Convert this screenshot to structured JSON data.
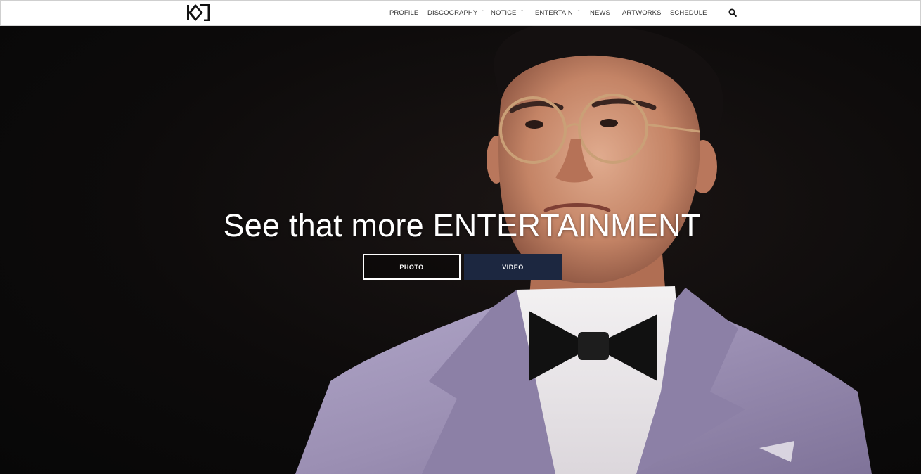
{
  "header": {
    "logo_alt": "KJ",
    "nav": [
      {
        "label": "PROFILE",
        "has_dropdown": false
      },
      {
        "label": "DISCOGRAPHY",
        "has_dropdown": true
      },
      {
        "label": "NOTICE",
        "has_dropdown": true
      },
      {
        "label": "ENTERTAIN",
        "has_dropdown": true
      },
      {
        "label": "NEWS",
        "has_dropdown": false
      },
      {
        "label": "ARTWORKS",
        "has_dropdown": false
      },
      {
        "label": "SCHEDULE",
        "has_dropdown": false
      }
    ],
    "dropdown_glyph": "ˇ",
    "search_icon": "search-icon"
  },
  "hero": {
    "title": "See that more ENTERTAINMENT",
    "buttons": {
      "photo_label": "PHOTO",
      "video_label": "VIDEO"
    }
  },
  "colors": {
    "nav_background": "#ffffff",
    "hero_background": "#0b0a0a",
    "video_button": "#1c2740",
    "suit": "#9b8fb3"
  }
}
